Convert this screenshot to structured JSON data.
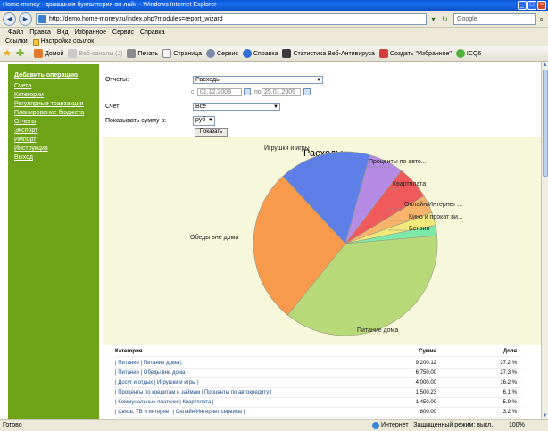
{
  "window": {
    "title": "Home money - домашняя бухгалтерия он-лайн - Windows Internet Explorer"
  },
  "address": {
    "url": "http://demo.home-money.ru/index.php?modules=report_wizard",
    "search_placeholder": "Google"
  },
  "menu": [
    "Файл",
    "Правка",
    "Вид",
    "Избранное",
    "Сервис",
    "Справка"
  ],
  "links_bar": {
    "label": "Ссылки",
    "item": "Настройка ссылок"
  },
  "toolbar": {
    "home": "Домой",
    "feeds": "Веб-каналы (J)",
    "print": "Печать",
    "page": "Страница",
    "tools": "Сервис",
    "help": "Справка",
    "stats": "Статистика Веб-Антивируса",
    "favorites": "Создать \"Избранное\"",
    "icq": "ICQ6"
  },
  "sidebar": {
    "items": [
      "Добавить операцию",
      "Счета",
      "Категории",
      "Регулярные транзакции",
      "Планирование бюджета",
      "Отчеты",
      "Экспорт",
      "Импорт",
      "Инструкция",
      "Выход"
    ]
  },
  "form": {
    "reports_label": "Отчеты:",
    "report_value": "Расходы",
    "from_label": "с:",
    "from_date": "01.12.2008",
    "to_label": "по:",
    "to_date": "25.01.2009",
    "account_label": "Счет:",
    "account_value": "Все",
    "currency_label": "Показывать сумму в:",
    "currency_value": "руб",
    "show_button": "Показать"
  },
  "chart_data": {
    "type": "pie",
    "title": "Расходы",
    "slices": [
      {
        "label": "Питание дома",
        "value": 37.2,
        "color": "#b8d977"
      },
      {
        "label": "Обеды вне дома",
        "value": 27.3,
        "color": "#f79a4c"
      },
      {
        "label": "Игрушки и игры",
        "value": 16.2,
        "color": "#5f7fe8"
      },
      {
        "label": "Проценты по авто...",
        "value": 6.1,
        "color": "#b58be6"
      },
      {
        "label": "Квартплата",
        "value": 5.9,
        "color": "#f05a5a"
      },
      {
        "label": "Онлайн/Интернет ...",
        "value": 3.2,
        "color": "#f7b46a"
      },
      {
        "label": "Кино и прокат ви...",
        "value": 2.3,
        "color": "#f3e97a"
      },
      {
        "label": "Бензин",
        "value": 1.8,
        "color": "#7ee8a8"
      }
    ]
  },
  "table": {
    "headers": [
      "Категория",
      "Сумма",
      "Доля"
    ],
    "rows": [
      [
        "| Питание | Питание дома |",
        "9 200.12",
        "37.2 %"
      ],
      [
        "| Питание | Обеды вне дома |",
        "6 750.00",
        "27.3 %"
      ],
      [
        "| Досуг и отдых | Игрушки и игры |",
        "4 000.00",
        "16.2 %"
      ],
      [
        "| Проценты по кредитам и займам | Проценты по автокредиту |",
        "1 500.23",
        "6.1 %"
      ],
      [
        "| Коммунальные платежи | Квартплата |",
        "1 450.00",
        "5.9 %"
      ],
      [
        "| Связь, ТВ и интернет | Онлайн/Интернет сервисы |",
        "800.00",
        "3.2 %"
      ]
    ]
  },
  "status": {
    "text": "Готово",
    "zone": "Интернет | Защищенный режим: выкл.",
    "zoom": "100%"
  }
}
